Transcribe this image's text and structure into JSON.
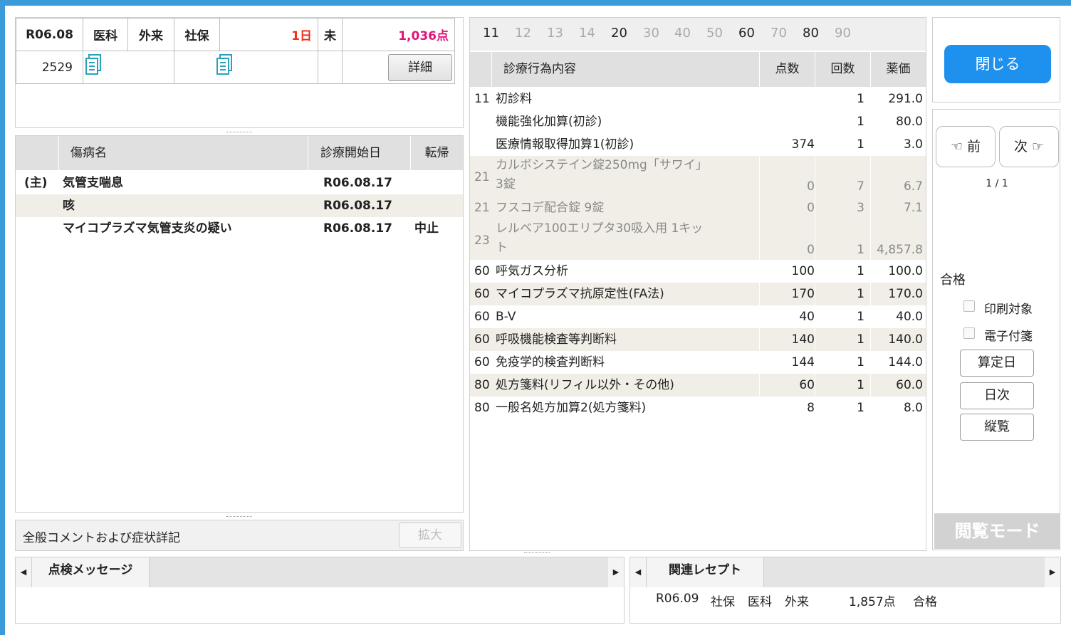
{
  "header": {
    "date": "R06.08",
    "dept": "医科",
    "visit_type": "外来",
    "insurance": "社保",
    "days": "1日",
    "status": "未",
    "points": "1,036点",
    "patient_no": "2529",
    "detail_button": "詳細"
  },
  "diseases": {
    "columns": [
      "傷病名",
      "診療開始日",
      "転帰"
    ],
    "rows": [
      {
        "mark": "(主)",
        "name": "気管支喘息",
        "start": "R06.08.17",
        "outcome": ""
      },
      {
        "mark": "",
        "name": "咳",
        "start": "R06.08.17",
        "outcome": ""
      },
      {
        "mark": "",
        "name": "マイコプラズマ気管支炎の疑い",
        "start": "R06.08.17",
        "outcome": "中止"
      }
    ]
  },
  "comment": {
    "label": "全般コメントおよび症状詳記",
    "expand_button": "拡大"
  },
  "procedures": {
    "tabs": [
      "11",
      "12",
      "13",
      "14",
      "20",
      "30",
      "40",
      "50",
      "60",
      "70",
      "80",
      "90"
    ],
    "columns": [
      "診療行為内容",
      "点数",
      "回数",
      "薬価"
    ],
    "rows": [
      {
        "code": "11",
        "name": "初診料",
        "name2": "",
        "points": "",
        "count": "1",
        "price": "291.0"
      },
      {
        "code": "",
        "name": "機能強化加算(初診)",
        "name2": "",
        "points": "",
        "count": "1",
        "price": "80.0"
      },
      {
        "code": "",
        "name": "医療情報取得加算1(初診)",
        "name2": "",
        "points": "374",
        "count": "1",
        "price": "3.0"
      },
      {
        "code": "21",
        "name": "カルボシステイン錠250mg「サワイ」",
        "name2": "3錠",
        "points": "0",
        "count": "7",
        "price": "6.7"
      },
      {
        "code": "21",
        "name": "フスコデ配合錠 9錠",
        "name2": "",
        "points": "0",
        "count": "3",
        "price": "7.1"
      },
      {
        "code": "23",
        "name": "レルベア100エリプタ30吸入用 1キッ",
        "name2": "ト",
        "points": "0",
        "count": "1",
        "price": "4,857.8"
      },
      {
        "code": "60",
        "name": "呼気ガス分析",
        "name2": "",
        "points": "100",
        "count": "1",
        "price": "100.0"
      },
      {
        "code": "60",
        "name": "マイコプラズマ抗原定性(FA法)",
        "name2": "",
        "points": "170",
        "count": "1",
        "price": "170.0"
      },
      {
        "code": "60",
        "name": "B-V",
        "name2": "",
        "points": "40",
        "count": "1",
        "price": "40.0"
      },
      {
        "code": "60",
        "name": "呼吸機能検査等判断料",
        "name2": "",
        "points": "140",
        "count": "1",
        "price": "140.0"
      },
      {
        "code": "60",
        "name": "免疫学的検査判断料",
        "name2": "",
        "points": "144",
        "count": "1",
        "price": "144.0"
      },
      {
        "code": "80",
        "name": "処方箋料(リフィル以外・その他)",
        "name2": "",
        "points": "60",
        "count": "1",
        "price": "60.0"
      },
      {
        "code": "80",
        "name": "一般名処方加算2(処方箋料)",
        "name2": "",
        "points": "8",
        "count": "1",
        "price": "8.0"
      }
    ]
  },
  "side": {
    "close_button": "閉じる",
    "prev_button": "☜ 前",
    "next_button": "次 ☞",
    "page": "1 / 1",
    "result": "合格",
    "print_target": "印刷対象",
    "e_tag": "電子付箋",
    "calc_date_button": "算定日",
    "daily_button": "日次",
    "vertical_button": "縦覧",
    "view_mode": "閲覧モード"
  },
  "bottom": {
    "check_tab": "点検メッセージ",
    "related_tab": "関連レセプト",
    "related_row": {
      "date": "R06.09",
      "insurance": "社保",
      "dept": "医科",
      "visit": "外来",
      "points": "1,857点",
      "result": "合格"
    }
  }
}
